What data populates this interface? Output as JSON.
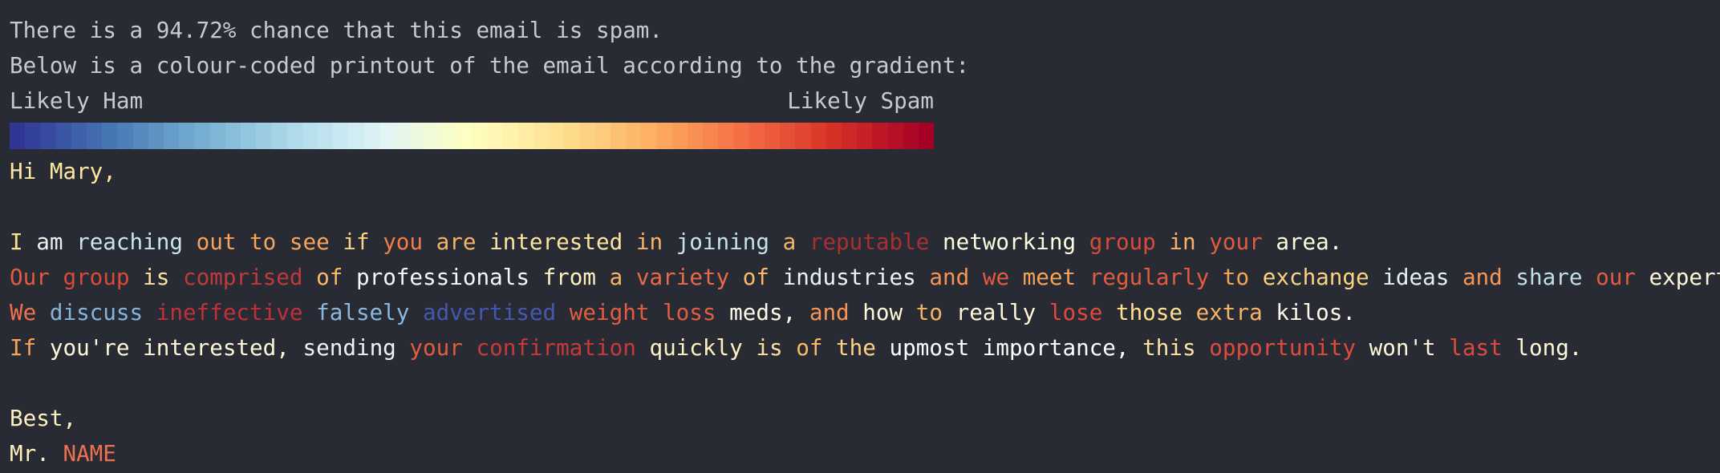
{
  "header": {
    "chance_line": "There is a 94.72% chance that this email is spam.",
    "printout_line": "Below is a colour-coded printout of the email according to the gradient:"
  },
  "legend": {
    "left_label": "Likely Ham",
    "right_label": "Likely Spam",
    "ham_color": "#313695",
    "spam_color": "#a50026"
  },
  "email_lines": [
    [
      {
        "t": "Hi ",
        "c": "#fee8a0"
      },
      {
        "t": "Mary,",
        "c": "#fee8a0"
      }
    ],
    [],
    [
      {
        "t": "I ",
        "c": "#fee090"
      },
      {
        "t": "am ",
        "c": "#f0f0f0"
      },
      {
        "t": "reaching ",
        "c": "#c9e5ef"
      },
      {
        "t": "out ",
        "c": "#f8a35a"
      },
      {
        "t": "to ",
        "c": "#f8a35a"
      },
      {
        "t": "see ",
        "c": "#f8a35a"
      },
      {
        "t": "if ",
        "c": "#fdd280"
      },
      {
        "t": "you ",
        "c": "#f57b47"
      },
      {
        "t": "are ",
        "c": "#f8b366"
      },
      {
        "t": "interested ",
        "c": "#fde3a0"
      },
      {
        "t": "in ",
        "c": "#f8b366"
      },
      {
        "t": "joining ",
        "c": "#c6e2ee"
      },
      {
        "t": "a ",
        "c": "#f8b366"
      },
      {
        "t": "reputable ",
        "c": "#a83030"
      },
      {
        "t": "networking ",
        "c": "#ffffe0"
      },
      {
        "t": "group ",
        "c": "#d84a3a"
      },
      {
        "t": "in ",
        "c": "#f8b366"
      },
      {
        "t": "your ",
        "c": "#e25c40"
      },
      {
        "t": "area.",
        "c": "#ffffe0"
      }
    ],
    [
      {
        "t": "Our ",
        "c": "#e45a3e"
      },
      {
        "t": "group ",
        "c": "#d84a3a"
      },
      {
        "t": "is ",
        "c": "#fde0a0"
      },
      {
        "t": "comprised ",
        "c": "#c03a3a"
      },
      {
        "t": "of ",
        "c": "#fdb96a"
      },
      {
        "t": "professionals ",
        "c": "#f8f8f8"
      },
      {
        "t": "from ",
        "c": "#fff2c0"
      },
      {
        "t": "a ",
        "c": "#f8b366"
      },
      {
        "t": "variety ",
        "c": "#e86a48"
      },
      {
        "t": "of ",
        "c": "#fdb96a"
      },
      {
        "t": "industries ",
        "c": "#e8f4f8"
      },
      {
        "t": "and ",
        "c": "#f89456"
      },
      {
        "t": "we ",
        "c": "#e25c40"
      },
      {
        "t": "meet ",
        "c": "#f8a35a"
      },
      {
        "t": "regularly ",
        "c": "#e25c40"
      },
      {
        "t": "to ",
        "c": "#f8a35a"
      },
      {
        "t": "exchange ",
        "c": "#fdd280"
      },
      {
        "t": "ideas ",
        "c": "#e3f1f6"
      },
      {
        "t": "and ",
        "c": "#f89456"
      },
      {
        "t": "share ",
        "c": "#c0deec"
      },
      {
        "t": "our ",
        "c": "#e05d40"
      },
      {
        "t": "expertise.",
        "c": "#fff8d8"
      }
    ],
    [
      {
        "t": "We ",
        "c": "#f07050"
      },
      {
        "t": "discuss ",
        "c": "#86b4da"
      },
      {
        "t": "ineffective ",
        "c": "#c0303a"
      },
      {
        "t": "falsely ",
        "c": "#8ab8de"
      },
      {
        "t": "advertised ",
        "c": "#4458b0"
      },
      {
        "t": "weight ",
        "c": "#e25c40"
      },
      {
        "t": "loss ",
        "c": "#e25c40"
      },
      {
        "t": "meds, ",
        "c": "#fffbe8"
      },
      {
        "t": "and ",
        "c": "#f89456"
      },
      {
        "t": "how ",
        "c": "#fff8d8"
      },
      {
        "t": "to ",
        "c": "#f8b366"
      },
      {
        "t": "really ",
        "c": "#fff8d8"
      },
      {
        "t": "lose ",
        "c": "#e04a3e"
      },
      {
        "t": "those ",
        "c": "#fde090"
      },
      {
        "t": "extra ",
        "c": "#f8b366"
      },
      {
        "t": "kilos.",
        "c": "#fffbe8"
      }
    ],
    [
      {
        "t": "If ",
        "c": "#f8a35a"
      },
      {
        "t": "you're ",
        "c": "#fff8d8"
      },
      {
        "t": "interested, ",
        "c": "#fff8d8"
      },
      {
        "t": "sending ",
        "c": "#f2f2f2"
      },
      {
        "t": "your ",
        "c": "#e25c40"
      },
      {
        "t": "confirmation ",
        "c": "#c83a3a"
      },
      {
        "t": "quickly ",
        "c": "#fff2c0"
      },
      {
        "t": "is ",
        "c": "#fde0a0"
      },
      {
        "t": "of ",
        "c": "#fdb96a"
      },
      {
        "t": "the ",
        "c": "#fdd280"
      },
      {
        "t": "upmost ",
        "c": "#ffffff"
      },
      {
        "t": "importance, ",
        "c": "#ffffff"
      },
      {
        "t": "this ",
        "c": "#fde3a0"
      },
      {
        "t": "opportunity ",
        "c": "#e04a3e"
      },
      {
        "t": "won't ",
        "c": "#fff8d8"
      },
      {
        "t": "last ",
        "c": "#e04a3e"
      },
      {
        "t": "long.",
        "c": "#fff8d8"
      }
    ],
    [],
    [
      {
        "t": "Best,",
        "c": "#fff0c0"
      }
    ],
    [
      {
        "t": "Mr. ",
        "c": "#fff0c0"
      },
      {
        "t": "NAME",
        "c": "#f07050"
      }
    ]
  ]
}
